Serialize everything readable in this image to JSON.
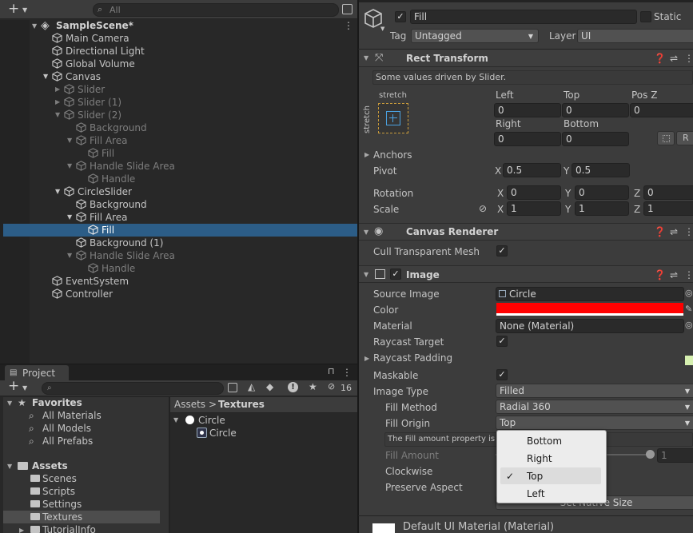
{
  "hierarchy": {
    "toolbar": {
      "add_label": "+",
      "search_placeholder": "All"
    },
    "scene": "SampleScene*",
    "items": [
      {
        "label": "Main Camera",
        "depth": 1,
        "arrow": "",
        "dim": false
      },
      {
        "label": "Directional Light",
        "depth": 1,
        "arrow": "",
        "dim": false
      },
      {
        "label": "Global Volume",
        "depth": 1,
        "arrow": "",
        "dim": false
      },
      {
        "label": "Canvas",
        "depth": 1,
        "arrow": "down",
        "dim": false
      },
      {
        "label": "Slider",
        "depth": 2,
        "arrow": "right",
        "dim": true
      },
      {
        "label": "Slider (1)",
        "depth": 2,
        "arrow": "right",
        "dim": true
      },
      {
        "label": "Slider (2)",
        "depth": 2,
        "arrow": "down",
        "dim": true
      },
      {
        "label": "Background",
        "depth": 3,
        "arrow": "",
        "dim": true
      },
      {
        "label": "Fill Area",
        "depth": 3,
        "arrow": "down",
        "dim": true
      },
      {
        "label": "Fill",
        "depth": 4,
        "arrow": "",
        "dim": true
      },
      {
        "label": "Handle Slide Area",
        "depth": 3,
        "arrow": "down",
        "dim": true
      },
      {
        "label": "Handle",
        "depth": 4,
        "arrow": "",
        "dim": true
      },
      {
        "label": "CircleSlider",
        "depth": 2,
        "arrow": "down",
        "dim": false
      },
      {
        "label": "Background",
        "depth": 3,
        "arrow": "",
        "dim": false
      },
      {
        "label": "Fill Area",
        "depth": 3,
        "arrow": "down",
        "dim": false
      },
      {
        "label": "Fill",
        "depth": 4,
        "arrow": "",
        "dim": false,
        "selected": true
      },
      {
        "label": "Background (1)",
        "depth": 3,
        "arrow": "",
        "dim": false
      },
      {
        "label": "Handle Slide Area",
        "depth": 3,
        "arrow": "down",
        "dim": true
      },
      {
        "label": "Handle",
        "depth": 4,
        "arrow": "",
        "dim": true
      },
      {
        "label": "EventSystem",
        "depth": 1,
        "arrow": "",
        "dim": false
      },
      {
        "label": "Controller",
        "depth": 1,
        "arrow": "",
        "dim": false
      }
    ]
  },
  "project": {
    "tab": "Project",
    "hidden_count": "16",
    "favorites": {
      "label": "Favorites",
      "items": [
        "All Materials",
        "All Models",
        "All Prefabs"
      ]
    },
    "assets": {
      "label": "Assets",
      "items": [
        "Scenes",
        "Scripts",
        "Settings",
        "Textures",
        "TutorialInfo"
      ]
    },
    "breadcrumb": {
      "root": "Assets",
      "sep": ">",
      "current": "Textures"
    },
    "files": {
      "parent": "Circle",
      "child": "Circle"
    }
  },
  "inspector": {
    "object": {
      "name": "Fill",
      "static_label": "Static",
      "tag_label": "Tag",
      "tag_value": "Untagged",
      "layer_label": "Layer",
      "layer_value": "UI"
    },
    "rect_transform": {
      "title": "Rect Transform",
      "note": "Some values driven by Slider.",
      "anchor_h": "stretch",
      "anchor_v": "stretch",
      "left_label": "Left",
      "left": "0",
      "top_label": "Top",
      "top": "0",
      "posz_label": "Pos Z",
      "posz": "0",
      "right_label": "Right",
      "right": "0",
      "bottom_label": "Bottom",
      "bottom": "0",
      "r_button": "R",
      "anchors_label": "Anchors",
      "pivot_label": "Pivot",
      "pivot_x": "0.5",
      "pivot_y": "0.5",
      "rotation_label": "Rotation",
      "rot_x": "0",
      "rot_y": "0",
      "rot_z": "0",
      "scale_label": "Scale",
      "scale_x": "1",
      "scale_y": "1",
      "scale_z": "1",
      "x": "X",
      "y": "Y",
      "z": "Z"
    },
    "canvas_renderer": {
      "title": "Canvas Renderer",
      "cull_label": "Cull Transparent Mesh"
    },
    "image": {
      "title": "Image",
      "source_label": "Source Image",
      "source_value": "Circle",
      "color_label": "Color",
      "color_value": "#ff0000",
      "material_label": "Material",
      "material_value": "None (Material)",
      "raycast_label": "Raycast Target",
      "padding_label": "Raycast Padding",
      "maskable_label": "Maskable",
      "type_label": "Image Type",
      "type_value": "Filled",
      "method_label": "Fill Method",
      "method_value": "Radial 360",
      "origin_label": "Fill Origin",
      "origin_value": "Top",
      "help_text": "The Fill amount property is d",
      "amount_label": "Fill Amount",
      "amount_value": "1",
      "clockwise_label": "Clockwise",
      "preserve_label": "Preserve Aspect",
      "native_button": "Set Native Size"
    },
    "dropdown": {
      "options": [
        "Bottom",
        "Right",
        "Top",
        "Left"
      ],
      "selected": "Top",
      "check": "✓"
    },
    "material_footer": "Default UI Material (Material)"
  }
}
